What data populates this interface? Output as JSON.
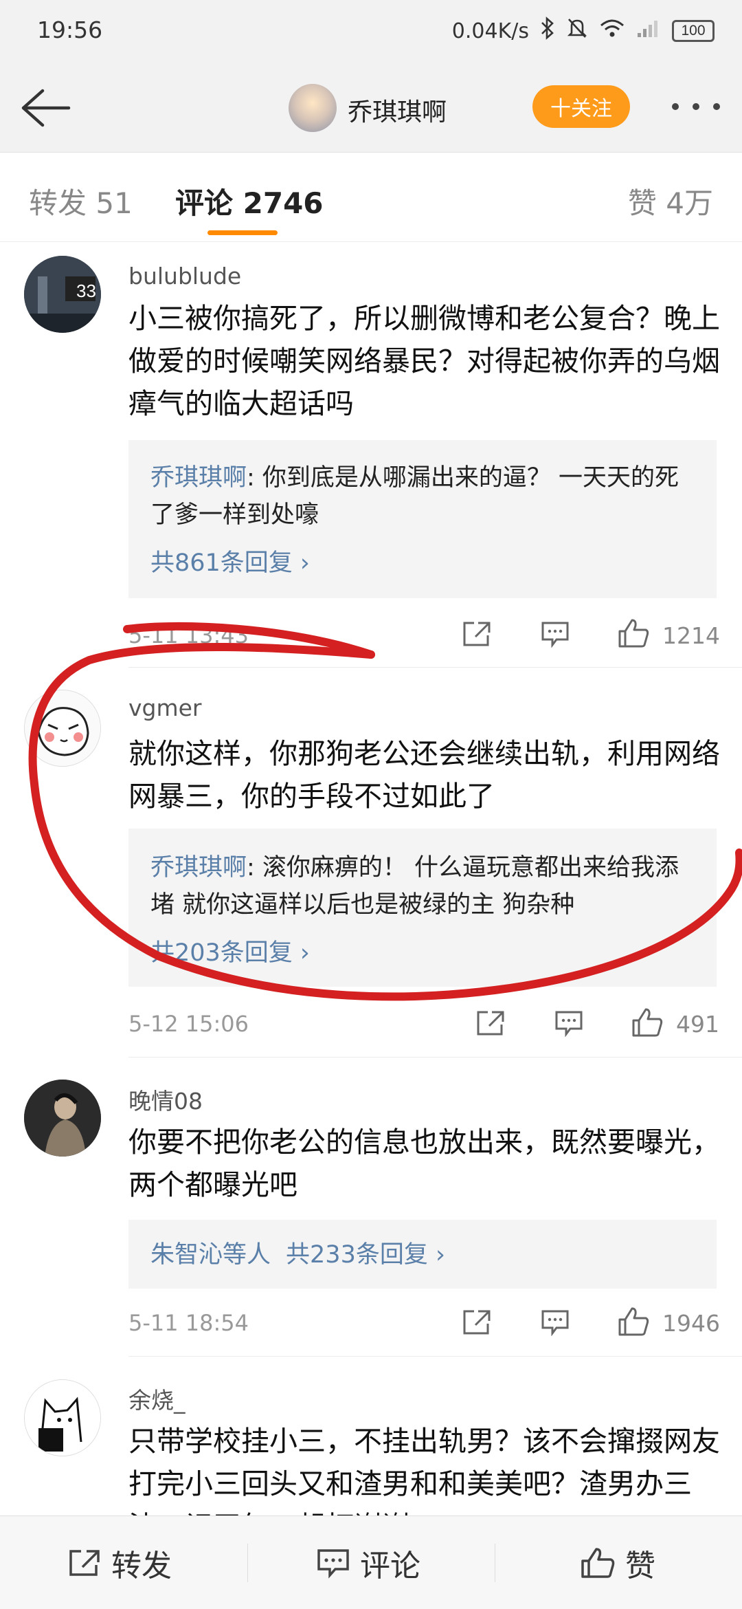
{
  "status_bar": {
    "time": "19:56",
    "network_speed": "0.04K/s",
    "battery": "100"
  },
  "header": {
    "profile_name": "乔琪琪啊",
    "follow_label": "十关注"
  },
  "tabs": {
    "repost": "转发 51",
    "comments": "评论 2746",
    "likes": "赞 4万"
  },
  "comments": [
    {
      "username": "bulublude",
      "text": "小三被你搞死了，所以删微博和老公复合？晚上做爱的时候嘲笑网络暴民？对得起被你弄的乌烟瘴气的临大超话吗",
      "reply_author": "乔琪琪啊",
      "reply_text": ": 你到底是从哪漏出来的逼？ 一天天的死了爹一样到处嚎",
      "reply_count": "共861条回复 ›",
      "time": "5-11 13:43",
      "likes": "1214"
    },
    {
      "username": "vgmer",
      "text": "就你这样，你那狗老公还会继续出轨，利用网络网暴三，你的手段不过如此了",
      "reply_author": "乔琪琪啊",
      "reply_text": ": 滚你麻痹的！ 什么逼玩意都出来给我添堵 就你这逼样以后也是被绿的主 狗杂种",
      "reply_count": "共203条回复 ›",
      "time": "5-12 15:06",
      "likes": "491"
    },
    {
      "username": "晚情08",
      "text": "你要不把你老公的信息也放出来，既然要曝光，两个都曝光吧",
      "reply_author": "朱智沁",
      "reply_suffix": "等人",
      "reply_count": "共233条回复 ›",
      "time": "5-11 18:54",
      "likes": "1946"
    },
    {
      "username": "余烧_",
      "text": "只带学校挂小三，不挂出轨男？该不会撺掇网友打完小三回头又和渣男和和美美吧？渣男办三渣，记天气一起打谢谢"
    }
  ],
  "bottom_bar": {
    "repost": "转发",
    "comment": "评论",
    "like": "赞"
  },
  "colors": {
    "accent": "#ff8a00",
    "follow": "#ff9b1a",
    "link": "#5a7fa8",
    "annotation": "#d42020"
  }
}
